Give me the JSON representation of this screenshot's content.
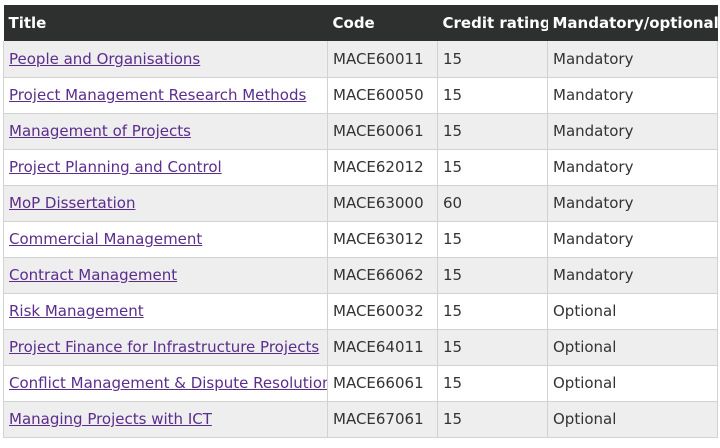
{
  "table": {
    "headers": {
      "title": "Title",
      "code": "Code",
      "credit": "Credit rating",
      "mandatory": "Mandatory/optional"
    },
    "rows": [
      {
        "title": "People and Organisations",
        "code": "MACE60011",
        "credit": "15",
        "status": "Mandatory"
      },
      {
        "title": "Project Management Research Methods",
        "code": "MACE60050",
        "credit": "15",
        "status": "Mandatory"
      },
      {
        "title": "Management of Projects",
        "code": "MACE60061",
        "credit": "15",
        "status": "Mandatory"
      },
      {
        "title": "Project Planning and Control",
        "code": "MACE62012",
        "credit": "15",
        "status": "Mandatory"
      },
      {
        "title": "MoP Dissertation",
        "code": "MACE63000",
        "credit": "60",
        "status": "Mandatory"
      },
      {
        "title": "Commercial Management",
        "code": "MACE63012",
        "credit": "15",
        "status": "Mandatory"
      },
      {
        "title": "Contract Management",
        "code": "MACE66062",
        "credit": "15",
        "status": "Mandatory"
      },
      {
        "title": "Risk Management",
        "code": "MACE60032",
        "credit": "15",
        "status": "Optional"
      },
      {
        "title": "Project Finance for Infrastructure Projects",
        "code": "MACE64011",
        "credit": "15",
        "status": "Optional"
      },
      {
        "title": "Conflict Management & Dispute Resolution",
        "code": "MACE66061",
        "credit": "15",
        "status": "Optional"
      },
      {
        "title": "Managing Projects with ICT",
        "code": "MACE67061",
        "credit": "15",
        "status": "Optional"
      }
    ]
  }
}
